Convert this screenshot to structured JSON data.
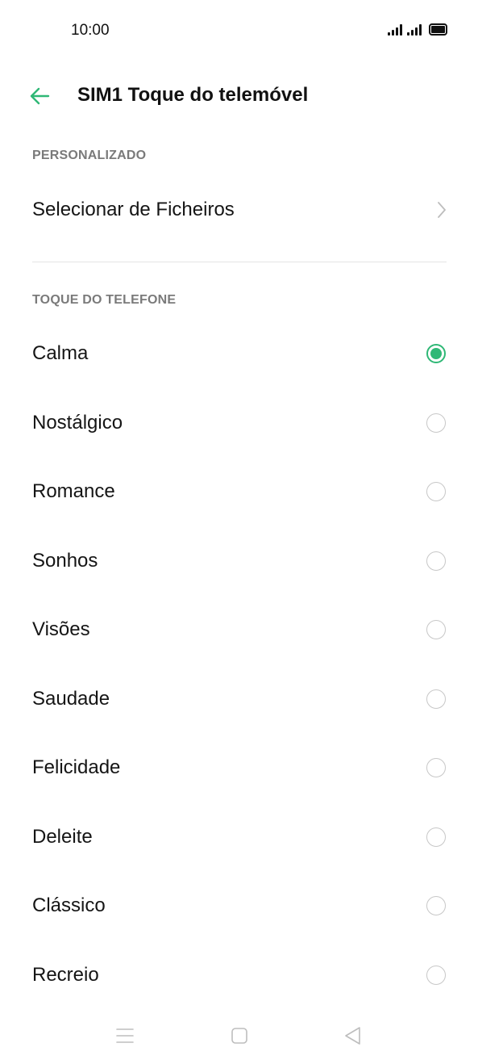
{
  "status_bar": {
    "time": "10:00",
    "icons": [
      "signal-sim1-icon",
      "signal-sim2-icon",
      "battery-icon"
    ]
  },
  "header": {
    "back_icon": "arrow-left-icon",
    "title": "SIM1 Toque do telemóvel"
  },
  "sections": {
    "custom": {
      "header": "PERSONALIZADO",
      "select_files_label": "Selecionar de Ficheiros",
      "chevron_icon": "chevron-right-icon"
    },
    "ringtones": {
      "header": "TOQUE DO TELEFONE",
      "items": [
        {
          "label": "Calma",
          "selected": true
        },
        {
          "label": "Nostálgico",
          "selected": false
        },
        {
          "label": "Romance",
          "selected": false
        },
        {
          "label": "Sonhos",
          "selected": false
        },
        {
          "label": "Visões",
          "selected": false
        },
        {
          "label": "Saudade",
          "selected": false
        },
        {
          "label": "Felicidade",
          "selected": false
        },
        {
          "label": "Deleite",
          "selected": false
        },
        {
          "label": "Clássico",
          "selected": false
        },
        {
          "label": "Recreio",
          "selected": false
        }
      ]
    }
  },
  "nav_bar": {
    "icons": [
      "menu-icon",
      "home-icon",
      "back-triangle-icon"
    ]
  },
  "colors": {
    "accent": "#2fb876",
    "section_header": "#7a7a7a",
    "divider": "#e4e4e4"
  }
}
